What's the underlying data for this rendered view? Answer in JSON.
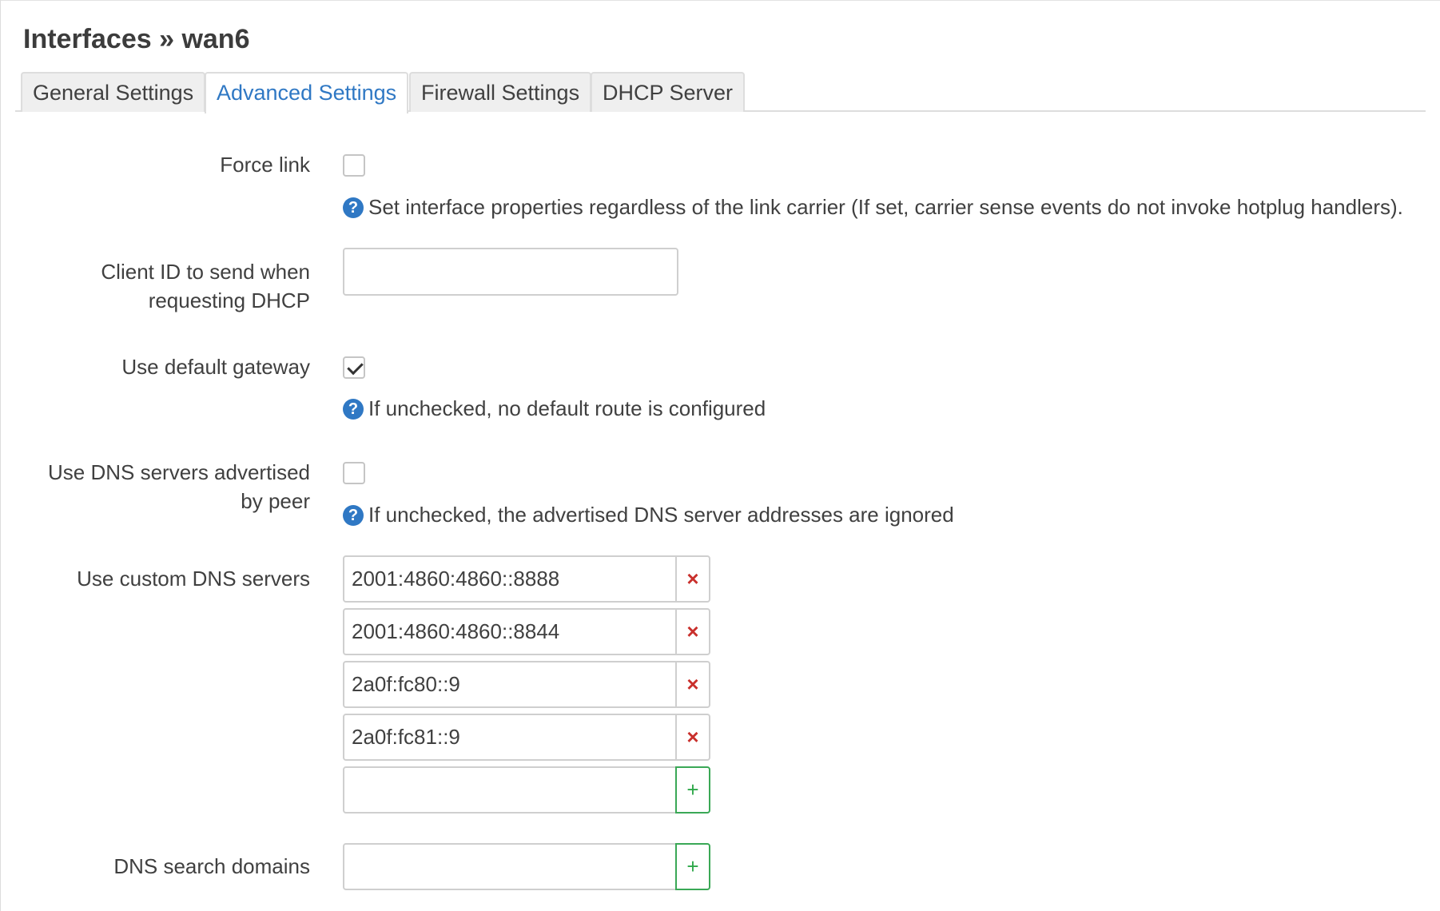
{
  "page": {
    "title": "Interfaces » wan6"
  },
  "tabs": [
    {
      "label": "General Settings",
      "active": false
    },
    {
      "label": "Advanced Settings",
      "active": true
    },
    {
      "label": "Firewall Settings",
      "active": false
    },
    {
      "label": "DHCP Server",
      "active": false
    }
  ],
  "form": {
    "force_link": {
      "label": "Force link",
      "checked": false,
      "help": "Set interface properties regardless of the link carrier (If set, carrier sense events do not invoke hotplug handlers)."
    },
    "client_id": {
      "label_line1": "Client ID to send when",
      "label_line2": "requesting DHCP",
      "value": ""
    },
    "default_gateway": {
      "label": "Use default gateway",
      "checked": true,
      "help": "If unchecked, no default route is configured"
    },
    "peer_dns": {
      "label_line1": "Use DNS servers advertised",
      "label_line2": "by peer",
      "checked": false,
      "help": "If unchecked, the advertised DNS server addresses are ignored"
    },
    "custom_dns": {
      "label": "Use custom DNS servers",
      "entries": [
        "2001:4860:4860::8888",
        "2001:4860:4860::8844",
        "2a0f:fc80::9",
        "2a0f:fc81::9"
      ],
      "new_value": ""
    },
    "dns_search": {
      "label": "DNS search domains",
      "new_value": ""
    }
  },
  "glyphs": {
    "help": "?",
    "remove": "×",
    "add": "+"
  },
  "colors": {
    "accent": "#2f78c4",
    "remove": "#c9302c",
    "add": "#2ea84a"
  }
}
